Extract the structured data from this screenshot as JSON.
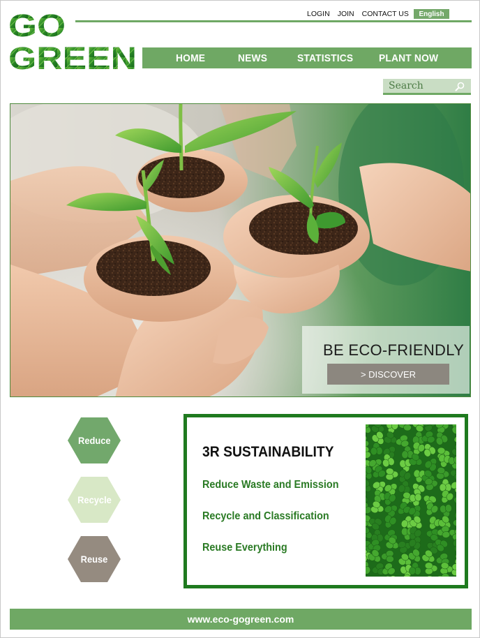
{
  "logo": {
    "line1": "GO",
    "line2": "GREEN"
  },
  "top_links": {
    "login": "LOGIN",
    "join": "JOIN",
    "contact": "CONTACT US",
    "language": "English"
  },
  "nav": {
    "items": [
      "HOME",
      "NEWS",
      "STATISTICS",
      "PLANT NOW"
    ]
  },
  "search": {
    "placeholder": "Search"
  },
  "hero": {
    "title": "BE ECO-FRIENDLY",
    "button": "> DISCOVER"
  },
  "hexagons": [
    {
      "label": "Reduce",
      "color": "#72a86c"
    },
    {
      "label": "Recycle",
      "color": "#d8e8c6"
    },
    {
      "label": "Reuse",
      "color": "#958b80"
    }
  ],
  "sustainability": {
    "title": "3R SUSTAINABILITY",
    "items": [
      "Reduce Waste and Emission",
      "Recycle and Classification",
      "Reuse Everything"
    ]
  },
  "footer": {
    "url": "www.eco-gogreen.com"
  },
  "colors": {
    "brand_green": "#6fa864",
    "dark_green": "#1f7a1f",
    "text_green": "#2a7a24"
  }
}
